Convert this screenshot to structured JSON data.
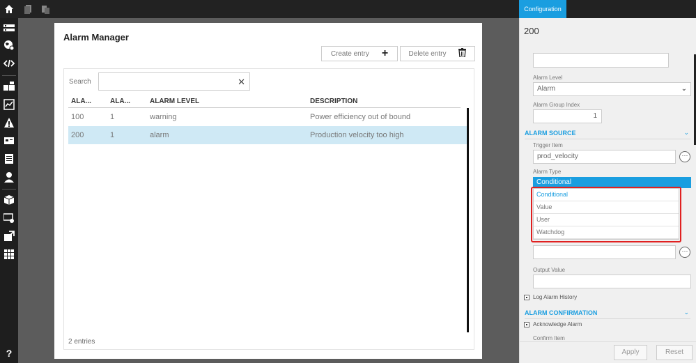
{
  "topbar": {
    "config_tab": "Configuration"
  },
  "alarm_manager": {
    "title": "Alarm Manager",
    "create_label": "Create entry",
    "delete_label": "Delete entry",
    "search_label": "Search",
    "search_value": "",
    "columns": [
      "ALA...",
      "ALA...",
      "ALARM LEVEL",
      "DESCRIPTION"
    ],
    "rows": [
      {
        "c1": "100",
        "c2": "1",
        "c3": "warning",
        "c4": "Power efficiency out of bound"
      },
      {
        "c1": "200",
        "c2": "1",
        "c3": "alarm",
        "c4": "Production velocity too high"
      }
    ],
    "entries": "2 entries"
  },
  "config": {
    "title": "200",
    "alarm_level_label": "Alarm Level",
    "alarm_level_value": "Alarm",
    "group_index_label": "Alarm Group Index",
    "group_index_value": "1",
    "section_source": "ALARM SOURCE",
    "trigger_item_label": "Trigger Item",
    "trigger_item_value": "prod_velocity",
    "alarm_type_label": "Alarm Type",
    "alarm_type_value": "Conditional",
    "alarm_type_options": [
      "Conditional",
      "Value",
      "User",
      "Watchdog"
    ],
    "output_value_label": "Output Value",
    "log_history_label": "Log Alarm History",
    "section_confirmation": "ALARM CONFIRMATION",
    "acknowledge_label": "Acknowledge Alarm",
    "confirm_item_label": "Confirm Item",
    "apply_label": "Apply",
    "reset_label": "Reset"
  }
}
